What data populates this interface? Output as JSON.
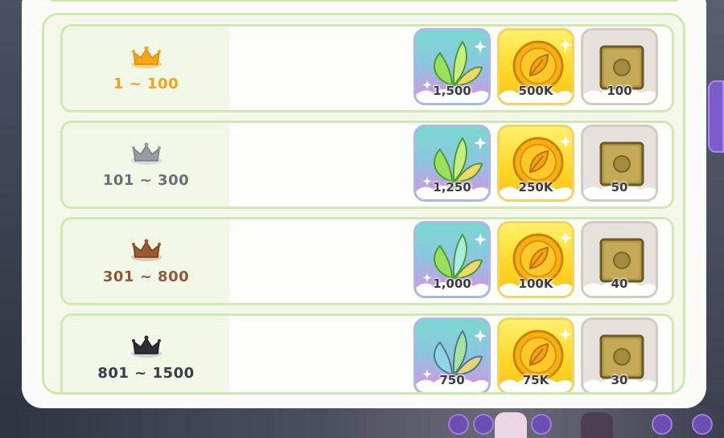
{
  "colors": {
    "panel": "#fbfcf8",
    "row_border": "#cfe9b2",
    "gold": "#f2a415",
    "silver": "#6d6f76",
    "bronze": "#8a5a3a",
    "black": "#3c3d44"
  },
  "reward_icons": [
    "crystal-flower-icon",
    "coin-icon",
    "stone-tablet-icon"
  ],
  "rows": [
    {
      "rank": "1 ~ 100",
      "crown": "gold-crown-icon",
      "rewards": {
        "seed": "1,500",
        "coin": "500K",
        "box": "100"
      }
    },
    {
      "rank": "101 ~ 300",
      "crown": "silver-crown-icon",
      "rewards": {
        "seed": "1,250",
        "coin": "250K",
        "box": "50"
      }
    },
    {
      "rank": "301 ~ 800",
      "crown": "bronze-crown-icon",
      "rewards": {
        "seed": "1,000",
        "coin": "100K",
        "box": "40"
      }
    },
    {
      "rank": "801 ~ 1500",
      "crown": "black-crown-icon",
      "rewards": {
        "seed": "750",
        "coin": "75K",
        "box": "30"
      }
    }
  ]
}
